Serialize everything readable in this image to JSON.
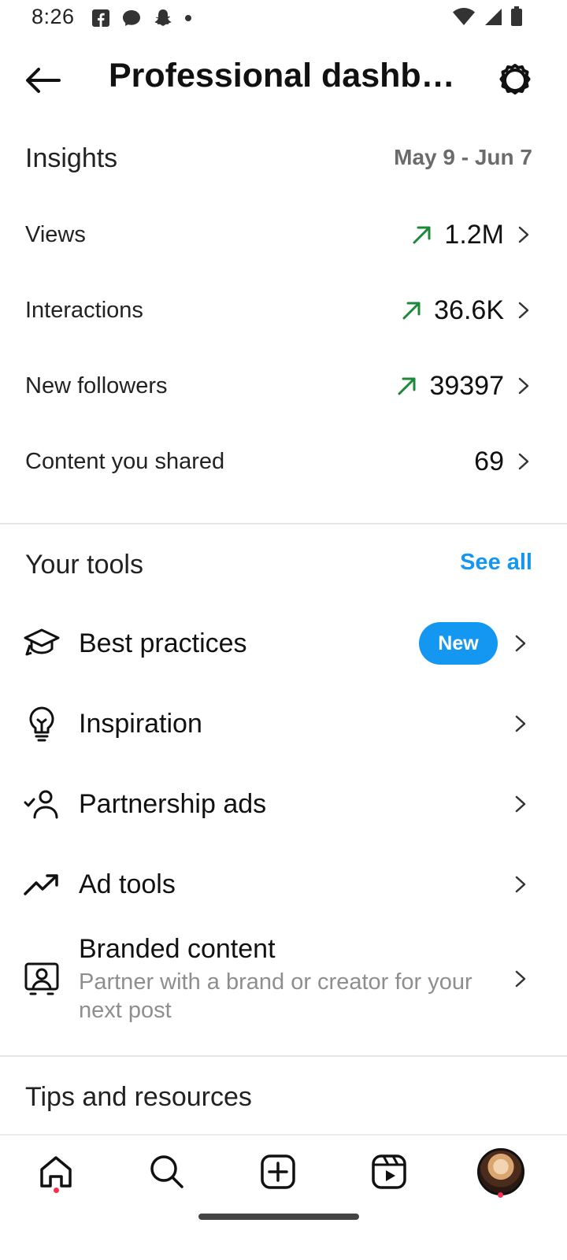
{
  "status_bar": {
    "time": "8:26",
    "left_icons": [
      "facebook-icon",
      "messenger-icon",
      "snapchat-icon",
      "dot-icon"
    ],
    "right_icons": [
      "wifi-icon",
      "cell-signal-icon",
      "battery-icon"
    ]
  },
  "header": {
    "title": "Professional dashb…",
    "back_icon": "back-arrow-icon",
    "settings_icon": "settings-gear-icon"
  },
  "insights": {
    "title": "Insights",
    "date_range": "May 9 - Jun 7",
    "metrics": [
      {
        "label": "Views",
        "value": "1.2M",
        "trend": "up"
      },
      {
        "label": "Interactions",
        "value": "36.6K",
        "trend": "up"
      },
      {
        "label": "New followers",
        "value": "39397",
        "trend": "up"
      },
      {
        "label": "Content you shared",
        "value": "69",
        "trend": "none"
      }
    ]
  },
  "tools": {
    "title": "Your tools",
    "see_all": "See all",
    "items": [
      {
        "label": "Best practices",
        "icon": "graduation-cap-icon",
        "badge": "New"
      },
      {
        "label": "Inspiration",
        "icon": "lightbulb-icon"
      },
      {
        "label": "Partnership ads",
        "icon": "person-check-icon"
      },
      {
        "label": "Ad tools",
        "icon": "trending-up-icon"
      },
      {
        "label": "Branded content",
        "icon": "branded-content-icon",
        "subtitle": "Partner with a brand or creator for your next post"
      }
    ]
  },
  "tips": {
    "title": "Tips and resources"
  },
  "bottom_nav": {
    "items": [
      "home-icon",
      "search-icon",
      "create-icon",
      "reels-icon",
      "profile-avatar"
    ]
  },
  "colors": {
    "accent": "#1497f0",
    "trend_up": "#1a8a3a",
    "notification_dot": "#ff2d55"
  }
}
